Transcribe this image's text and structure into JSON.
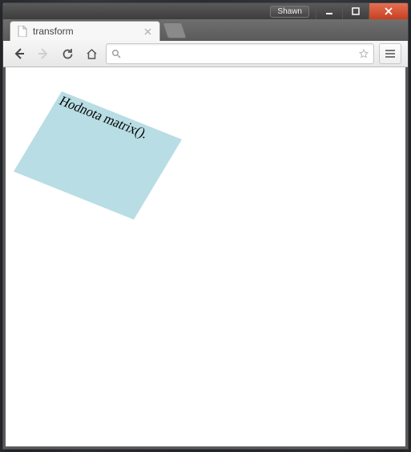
{
  "titlebar": {
    "user_label": "Shawn"
  },
  "tab": {
    "title": "transform"
  },
  "toolbar": {
    "omnibox_value": ""
  },
  "page": {
    "box_text": "Hodnota matrix()."
  }
}
